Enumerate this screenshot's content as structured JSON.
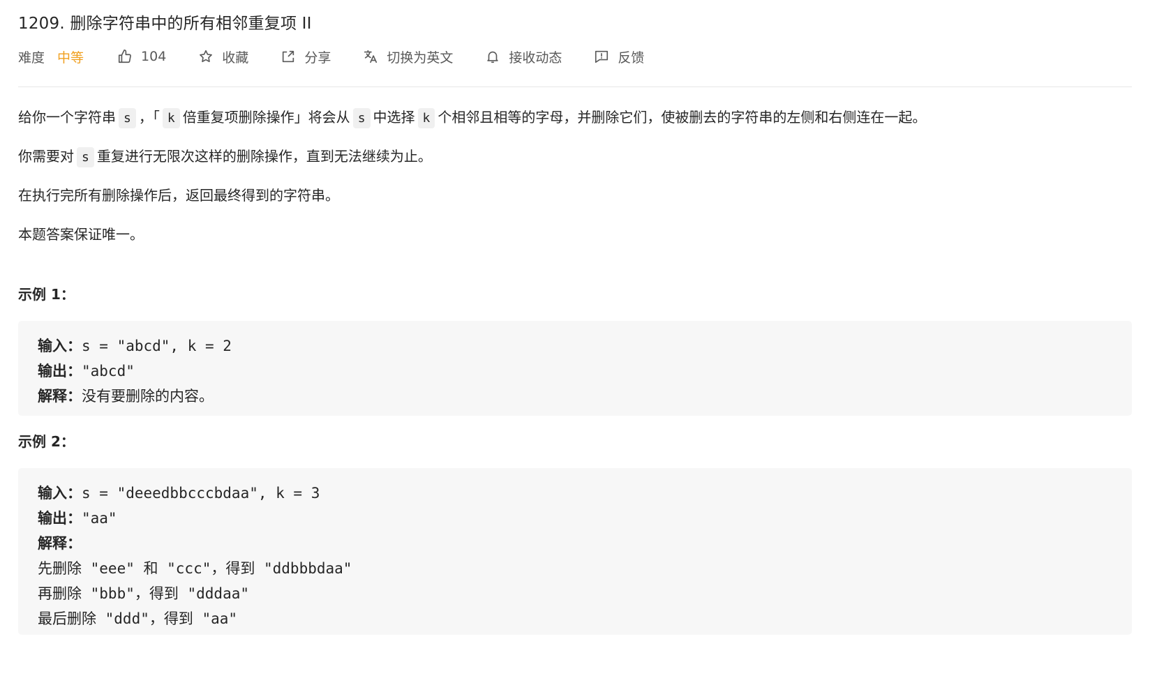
{
  "problem": {
    "title": "1209. 删除字符串中的所有相邻重复项 II"
  },
  "meta": {
    "difficulty_label": "难度",
    "difficulty_value": "中等",
    "likes": "104",
    "favorite": "收藏",
    "share": "分享",
    "switch_language": "切换为英文",
    "subscribe": "接收动态",
    "feedback": "反馈",
    "colors": {
      "difficulty": "#f0a020",
      "text": "#595959"
    },
    "icons": [
      "thumbs-up-icon",
      "star-icon",
      "share-icon",
      "translate-icon",
      "bell-icon",
      "feedback-icon"
    ]
  },
  "description": {
    "p1": {
      "t1": "给你一个字符串",
      "c1": "s",
      "t2": "，「",
      "c2": "k",
      "t3": "倍重复项删除操作」将会从",
      "c3": "s",
      "t4": "中选择",
      "c4": "k",
      "t5": "个相邻且相等的字母，并删除它们，使被删去的字符串的左侧和右侧连在一起。"
    },
    "p2": {
      "t1": "你需要对",
      "c1": "s",
      "t2": "重复进行无限次这样的删除操作，直到无法继续为止。"
    },
    "p3": "在执行完所有删除操作后，返回最终得到的字符串。",
    "p4": "本题答案保证唯一。"
  },
  "examples": [
    {
      "title": "示例 1：",
      "input_label": "输入：",
      "input_value": "s = \"abcd\", k = 2",
      "output_label": "输出：",
      "output_value": "\"abcd\"",
      "explain_label": "解释：",
      "explain_value": "没有要删除的内容。"
    },
    {
      "title": "示例 2：",
      "input_label": "输入：",
      "input_value": "s = \"deeedbbcccbdaa\", k = 3",
      "output_label": "输出：",
      "output_value": "\"aa\"",
      "explain_label": "解释：",
      "steps": [
        "先删除 \"eee\" 和 \"ccc\"，得到 \"ddbbbdaa\"",
        "再删除 \"bbb\"，得到 \"dddaa\"",
        "最后删除 \"ddd\"，得到 \"aa\""
      ]
    }
  ]
}
